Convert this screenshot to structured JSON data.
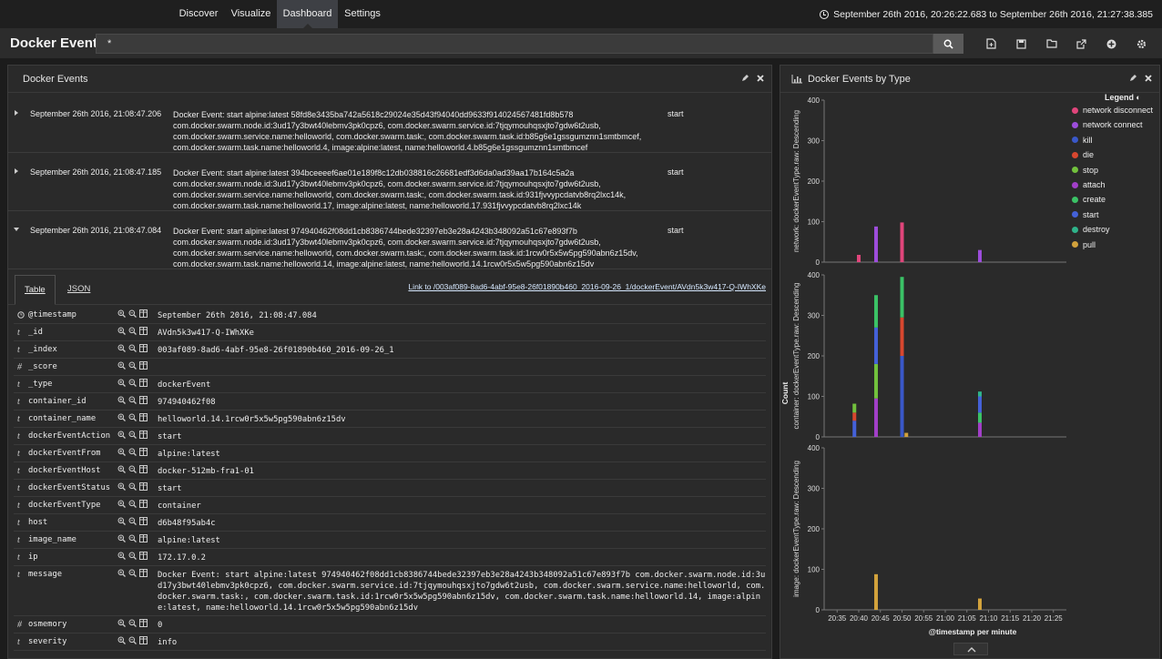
{
  "nav": {
    "tabs": [
      "Discover",
      "Visualize",
      "Dashboard",
      "Settings"
    ],
    "active": "Dashboard",
    "time_range": "September 26th 2016, 20:26:22.683 to September 26th 2016, 21:27:38.385"
  },
  "search": {
    "title": "Docker Events",
    "query": "*"
  },
  "left_panel": {
    "title": "Docker Events",
    "rows": [
      {
        "time": "September 26th 2016, 21:08:47.206",
        "message": "Docker Event: start alpine:latest 58fd8e3435ba742a5618c29024e35d43f94040dd9633f914024567481fd8b578 com.docker.swarm.node.id:3ud17y3bwt40lebmv3pk0cpz6, com.docker.swarm.service.id:7tjqymouhqsxjto7gdw6t2usb, com.docker.swarm.service.name:helloworld, com.docker.swarm.task:, com.docker.swarm.task.id:b85g6e1gssgumznn1smtbmcef, com.docker.swarm.task.name:helloworld.4, image:alpine:latest, name:helloworld.4.b85g6e1gssgumznn1smtbmcef",
        "action": "start"
      },
      {
        "time": "September 26th 2016, 21:08:47.185",
        "message": "Docker Event: start alpine:latest 394bceeeef6ae01e189f8c12db038816c26681edf3d6da0ad39aa17b164c5a2a com.docker.swarm.node.id:3ud17y3bwt40lebmv3pk0cpz6, com.docker.swarm.service.id:7tjqymouhqsxjto7gdw6t2usb, com.docker.swarm.service.name:helloworld, com.docker.swarm.task:, com.docker.swarm.task.id:931fjvvypcdatvb8rq2lxc14k, com.docker.swarm.task.name:helloworld.17, image:alpine:latest, name:helloworld.17.931fjvvypcdatvb8rq2lxc14k",
        "action": "start"
      },
      {
        "time": "September 26th 2016, 21:08:47.084",
        "message": "Docker Event: start alpine:latest 974940462f08dd1cb8386744bede32397eb3e28a4243b348092a51c67e893f7b com.docker.swarm.node.id:3ud17y3bwt40lebmv3pk0cpz6, com.docker.swarm.service.id:7tjqymouhqsxjto7gdw6t2usb, com.docker.swarm.service.name:helloworld, com.docker.swarm.task:, com.docker.swarm.task.id:1rcw0r5x5w5pg590abn6z15dv, com.docker.swarm.task.name:helloworld.14, image:alpine:latest, name:helloworld.14.1rcw0r5x5w5pg590abn6z15dv",
        "action": "start"
      }
    ],
    "detail": {
      "tab_table": "Table",
      "tab_json": "JSON",
      "link": "Link to /003af089-8ad6-4abf-95e8-26f01890b460_2016-09-26_1/dockerEvent/AVdn5k3w417-Q-IWhXKe",
      "fields": [
        {
          "type": "clock",
          "name": "@timestamp",
          "value": "September 26th 2016, 21:08:47.084"
        },
        {
          "type": "t",
          "name": "_id",
          "value": "AVdn5k3w417-Q-IWhXKe"
        },
        {
          "type": "t",
          "name": "_index",
          "value": "003af089-8ad6-4abf-95e8-26f01890b460_2016-09-26_1"
        },
        {
          "type": "#",
          "name": "_score",
          "value": ""
        },
        {
          "type": "t",
          "name": "_type",
          "value": "dockerEvent"
        },
        {
          "type": "t",
          "name": "container_id",
          "value": "974940462f08"
        },
        {
          "type": "t",
          "name": "container_name",
          "value": "helloworld.14.1rcw0r5x5w5pg590abn6z15dv"
        },
        {
          "type": "t",
          "name": "dockerEventAction",
          "value": "start"
        },
        {
          "type": "t",
          "name": "dockerEventFrom",
          "value": "alpine:latest"
        },
        {
          "type": "t",
          "name": "dockerEventHost",
          "value": "docker-512mb-fra1-01"
        },
        {
          "type": "t",
          "name": "dockerEventStatus",
          "value": "start"
        },
        {
          "type": "t",
          "name": "dockerEventType",
          "value": "container"
        },
        {
          "type": "t",
          "name": "host",
          "value": "d6b48f95ab4c"
        },
        {
          "type": "t",
          "name": "image_name",
          "value": "alpine:latest"
        },
        {
          "type": "t",
          "name": "ip",
          "value": "172.17.0.2"
        },
        {
          "type": "t",
          "name": "message",
          "value": "Docker Event: start alpine:latest 974940462f08dd1cb8386744bede32397eb3e28a4243b348092a51c67e893f7b com.docker.swarm.node.id:3ud17y3bwt40lebmv3pk0cpz6, com.docker.swarm.service.id:7tjqymouhqsxjto7gdw6t2usb, com.docker.swarm.service.name:helloworld, com.docker.swarm.task:, com.docker.swarm.task.id:1rcw0r5x5w5pg590abn6z15dv, com.docker.swarm.task.name:helloworld.14, image:alpine:latest, name:helloworld.14.1rcw0r5x5w5pg590abn6z15dv"
        },
        {
          "type": "#",
          "name": "osmemory",
          "value": "0"
        },
        {
          "type": "t",
          "name": "severity",
          "value": "info"
        }
      ]
    }
  },
  "right_panel": {
    "title": "Docker Events by Type"
  },
  "chart_data": {
    "type": "bar",
    "stacked": true,
    "xlabel": "@timestamp per minute",
    "ylabel": "Count",
    "x_ticks": [
      "20:35",
      "20:40",
      "20:45",
      "20:50",
      "20:55",
      "21:00",
      "21:05",
      "21:10",
      "21:15",
      "21:20",
      "21:25"
    ],
    "legend_title": "Legend",
    "legend_position": "right",
    "legend": [
      {
        "name": "network disconnect",
        "color": "#e0457b"
      },
      {
        "name": "network connect",
        "color": "#9d4ddb"
      },
      {
        "name": "kill",
        "color": "#3a58c9"
      },
      {
        "name": "die",
        "color": "#d8472f"
      },
      {
        "name": "stop",
        "color": "#72c13d"
      },
      {
        "name": "attach",
        "color": "#a23fc8"
      },
      {
        "name": "create",
        "color": "#3bc266"
      },
      {
        "name": "start",
        "color": "#4461d8"
      },
      {
        "name": "destroy",
        "color": "#2fb38a"
      },
      {
        "name": "pull",
        "color": "#d2a23c"
      }
    ],
    "panels": [
      {
        "label": "network: dockerEventType.raw: Descending",
        "ylim": [
          0,
          400
        ],
        "y_ticks": [
          0,
          100,
          200,
          300,
          400
        ],
        "bars": [
          {
            "x": "20:40",
            "segments": [
              {
                "series": "network disconnect",
                "value": 18
              }
            ]
          },
          {
            "x": "20:44",
            "segments": [
              {
                "series": "network connect",
                "value": 88
              }
            ]
          },
          {
            "x": "20:50",
            "segments": [
              {
                "series": "network disconnect",
                "value": 98
              }
            ]
          },
          {
            "x": "21:08",
            "segments": [
              {
                "series": "network connect",
                "value": 30
              }
            ]
          }
        ]
      },
      {
        "label": "container: dockerEventType.raw: Descending",
        "ylim": [
          0,
          400
        ],
        "y_ticks": [
          0,
          100,
          200,
          300,
          400
        ],
        "bars": [
          {
            "x": "20:39",
            "segments": [
              {
                "series": "start",
                "value": 40
              },
              {
                "series": "die",
                "value": 20
              },
              {
                "series": "stop",
                "value": 22
              }
            ]
          },
          {
            "x": "20:44",
            "segments": [
              {
                "series": "attach",
                "value": 95
              },
              {
                "series": "stop",
                "value": 85
              },
              {
                "series": "start",
                "value": 90
              },
              {
                "series": "create",
                "value": 80
              }
            ]
          },
          {
            "x": "20:50",
            "segments": [
              {
                "series": "kill",
                "value": 200
              },
              {
                "series": "die",
                "value": 95
              },
              {
                "series": "create",
                "value": 100
              }
            ]
          },
          {
            "x": "20:51",
            "segments": [
              {
                "series": "pull",
                "value": 10
              }
            ]
          },
          {
            "x": "21:08",
            "segments": [
              {
                "series": "attach",
                "value": 35
              },
              {
                "series": "create",
                "value": 25
              },
              {
                "series": "start",
                "value": 40
              },
              {
                "series": "destroy",
                "value": 12
              }
            ]
          }
        ]
      },
      {
        "label": "image: dockerEventType.raw: Descending",
        "ylim": [
          0,
          400
        ],
        "y_ticks": [
          0,
          100,
          200,
          300,
          400
        ],
        "bars": [
          {
            "x": "20:44",
            "segments": [
              {
                "series": "pull",
                "value": 88
              }
            ]
          },
          {
            "x": "21:08",
            "segments": [
              {
                "series": "pull",
                "value": 28
              }
            ]
          }
        ]
      }
    ]
  }
}
